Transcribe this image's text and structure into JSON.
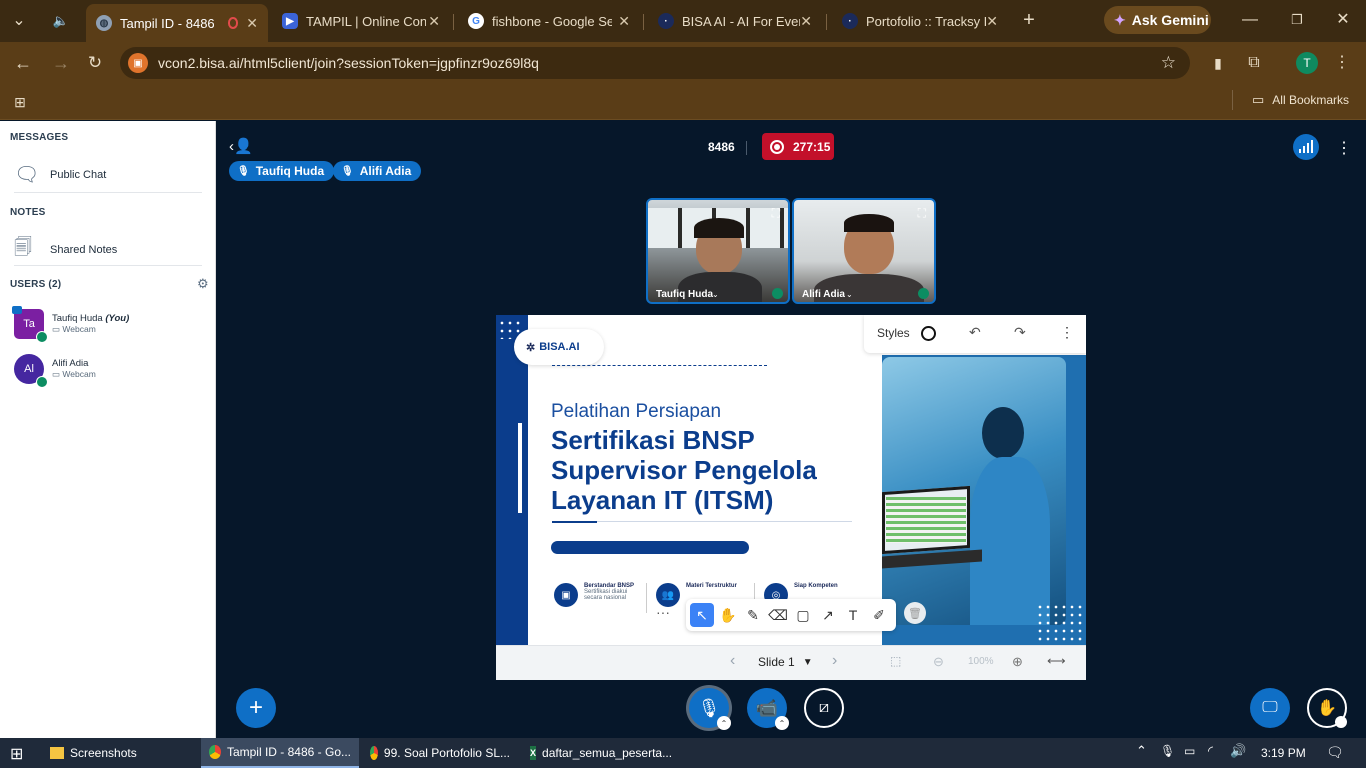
{
  "browser": {
    "tabs": [
      {
        "title": "Tampil ID - 8486",
        "active": true
      },
      {
        "title": "TAMPIL | Online Conf",
        "active": false
      },
      {
        "title": "fishbone - Google Se",
        "active": false
      },
      {
        "title": "BISA AI - AI For Every",
        "active": false
      },
      {
        "title": "Portofolio :: Tracksy D",
        "active": false
      }
    ],
    "ask_gemini": "Ask Gemini",
    "url": "vcon2.bisa.ai/html5client/join?sessionToken=jgpfinzr9oz69l8q",
    "profile_initial": "T",
    "all_bookmarks": "All Bookmarks"
  },
  "sidebar": {
    "messages_heading": "MESSAGES",
    "public_chat": "Public Chat",
    "notes_heading": "NOTES",
    "shared_notes": "Shared Notes",
    "users_heading": "USERS (2)",
    "users": [
      {
        "initials": "Ta",
        "name": "Taufiq Huda",
        "you": "(You)",
        "status": "Webcam",
        "color": "#7b1fa2"
      },
      {
        "initials": "Al",
        "name": "Alifi Adia",
        "status": "Webcam",
        "color": "#4527a0"
      }
    ]
  },
  "meeting": {
    "id": "8486",
    "timer": "277:15",
    "talkers": [
      "Taufiq Huda",
      "Alifi Adia"
    ],
    "videos": [
      {
        "name": "Taufiq Huda"
      },
      {
        "name": "Alifi Adia"
      }
    ]
  },
  "slide": {
    "logo": "BISA.AI",
    "kicker": "Pelatihan Persiapan",
    "title_lines": [
      "Sertifikasi BNSP",
      "Supervisor Pengelola",
      "Layanan IT (ITSM)"
    ],
    "features": [
      {
        "title": "Berstandar BNSP",
        "desc": "Sertifikasi diakui secara nasional"
      },
      {
        "title": "Materi Terstruktur",
        "desc": ""
      },
      {
        "title": "Siap Kompeten",
        "desc": ""
      }
    ]
  },
  "whiteboard": {
    "styles_label": "Styles",
    "slide_label": "Slide 1",
    "zoom": "100%"
  },
  "taskbar": {
    "items": [
      "Screenshots",
      "Tampil ID - 8486 - Go...",
      "99. Soal Portofolio SL...",
      "daftar_semua_peserta..."
    ],
    "time": "3:19 PM"
  }
}
